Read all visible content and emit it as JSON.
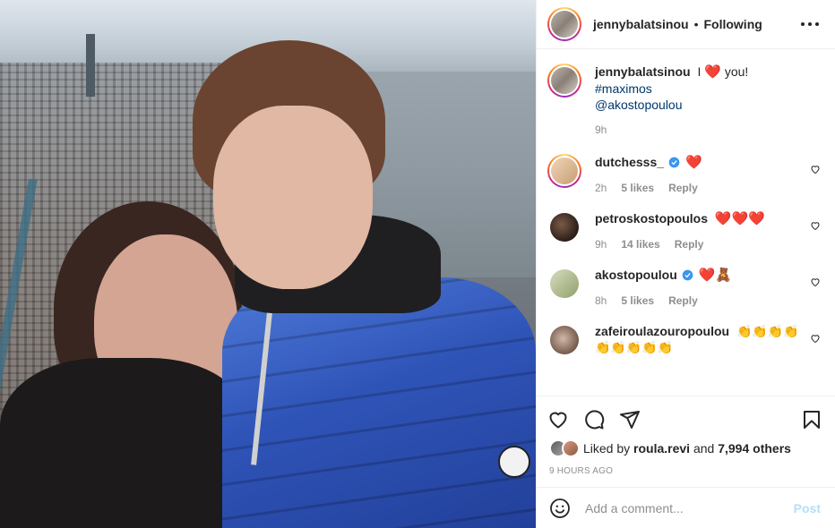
{
  "header": {
    "username": "jennybalatsinou",
    "separator": "•",
    "follow_status": "Following",
    "more_icon": "more-horizontal-icon"
  },
  "caption": {
    "username": "jennybalatsinou",
    "pipe": "I",
    "heart": "❤️",
    "text": "you!",
    "hashtag": "#maximos",
    "mention": "@akostopoulou",
    "time": "9h"
  },
  "comments": [
    {
      "username": "dutchesss_",
      "verified": true,
      "text": "❤️",
      "time": "2h",
      "likes": "5 likes",
      "reply": "Reply",
      "avatar_color": "#e6c9a8"
    },
    {
      "username": "petroskostopoulos",
      "verified": false,
      "text": "❤️❤️❤️",
      "time": "9h",
      "likes": "14 likes",
      "reply": "Reply",
      "avatar_color": "#3c2a22"
    },
    {
      "username": "akostopoulou",
      "verified": true,
      "text": "❤️🧸",
      "time": "8h",
      "likes": "5 likes",
      "reply": "Reply",
      "avatar_color": "#a8b48c"
    },
    {
      "username": "zafeiroulazouropoulou",
      "verified": false,
      "text": "👏👏👏👏👏👏👏👏👏",
      "time": "",
      "likes": "",
      "reply": "",
      "avatar_color": "#b59a8a"
    }
  ],
  "actions": {
    "like_icon": "heart-outline-icon",
    "comment_icon": "comment-bubble-icon",
    "share_icon": "paper-plane-icon",
    "save_icon": "bookmark-icon"
  },
  "likes": {
    "prefix": "Liked by",
    "user": "roula.revi",
    "middle": "and",
    "others": "7,994 others"
  },
  "timestamp": "9 HOURS AGO",
  "add_comment": {
    "emoji_icon": "smiley-face-icon",
    "placeholder": "Add a comment...",
    "post_label": "Post"
  },
  "colors": {
    "link": "#00376b",
    "secondary": "#8e8e8e",
    "heart": "#e0245e",
    "verified": "#3897f0",
    "post_disabled": "#b2dffc"
  }
}
